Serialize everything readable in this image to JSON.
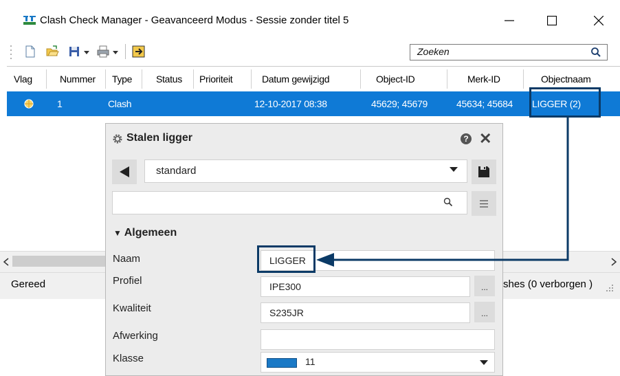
{
  "window": {
    "title": "Clash Check Manager - Geavanceerd Modus - Sessie zonder titel 5",
    "icon": "app-icon",
    "controls": [
      "minimize-icon",
      "maximize-icon",
      "close-icon"
    ]
  },
  "toolbar": {
    "icons": [
      "new-document-icon",
      "open-folder-icon",
      "save-icon",
      "print-icon",
      "export-icon"
    ],
    "search_placeholder": "Zoeken",
    "search_icon": "search-icon"
  },
  "table": {
    "columns": [
      "Vlag",
      "Nummer",
      "Type",
      "Status",
      "Prioriteit",
      "Datum gewijzigd",
      "Object-ID",
      "Merk-ID",
      "Objectnaam"
    ],
    "rows": [
      {
        "vlag": "flag-icon",
        "nummer": "1",
        "type": "Clash",
        "status": "",
        "prioriteit": "",
        "datum": "12-10-2017 08:38",
        "object_id": "45629; 45679",
        "merk_id": "45634; 45684",
        "objectnaam": "LIGGER (2)"
      }
    ],
    "selected_row_color": "#0f7ad6"
  },
  "statusbar": {
    "left": "Gereed",
    "right": "shes (0 verborgen )"
  },
  "panel": {
    "title": "Stalen ligger",
    "preset": "standard",
    "filter_value": "",
    "section": "Algemeen",
    "fields": [
      {
        "label": "Naam",
        "value": "LIGGER"
      },
      {
        "label": "Profiel",
        "value": "IPE300"
      },
      {
        "label": "Kwaliteit",
        "value": "S235JR"
      },
      {
        "label": "Afwerking",
        "value": ""
      },
      {
        "label": "Klasse",
        "value": "11"
      }
    ],
    "dots_label": "...",
    "klasse_color": "#1a79c6"
  },
  "annotation_color": "#0b3a66"
}
